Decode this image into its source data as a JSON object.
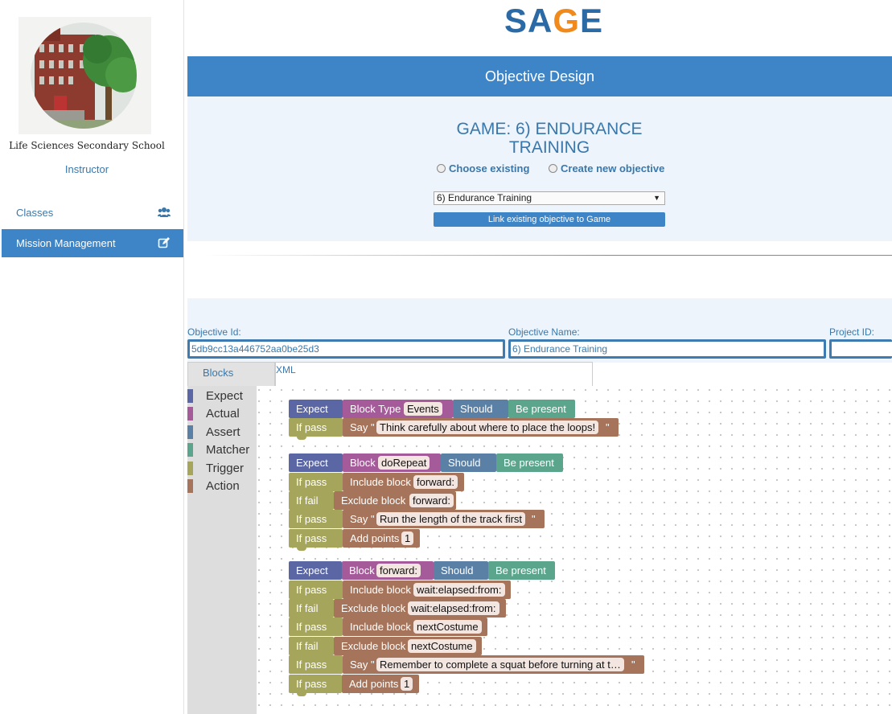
{
  "sidebar": {
    "school_name": "Life Sciences Secondary School",
    "role": "Instructor",
    "nav": [
      {
        "label": "Classes",
        "icon": "users-icon"
      },
      {
        "label": "Mission Management",
        "icon": "edit-icon"
      }
    ]
  },
  "header": {
    "logo_text": "SAGE",
    "bar_title": "Objective Design"
  },
  "objective": {
    "game_title": "GAME: 6) ENDURANCE TRAINING",
    "option_existing": "Choose existing",
    "option_new": "Create new objective",
    "selected": "6) Endurance Training",
    "link_button": "Link existing objective to Game"
  },
  "fields": {
    "id_label": "Objective Id:",
    "id_value": "5db9cc13a446752aa0be25d3",
    "name_label": "Objective Name:",
    "name_value": "6) Endurance Training",
    "project_label": "Project ID:",
    "project_value": ""
  },
  "tabs": {
    "blocks": "Blocks",
    "xml": "XML"
  },
  "toolbox": [
    {
      "label": "Expect",
      "color": "#5b67a5"
    },
    {
      "label": "Actual",
      "color": "#a55b99"
    },
    {
      "label": "Assert",
      "color": "#5b80a5"
    },
    {
      "label": "Matcher",
      "color": "#5ba58c"
    },
    {
      "label": "Trigger",
      "color": "#a5a55b"
    },
    {
      "label": "Action",
      "color": "#a5745b"
    }
  ],
  "blocks": {
    "expect": "Expect",
    "should": "Should",
    "be_present": "Be present",
    "if_pass": "If pass",
    "if_fail": "If fail",
    "say": "Say \"",
    "say_close": "\"",
    "include_block": "Include block",
    "exclude_block": "Exclude block",
    "add_points": "Add points",
    "g1": {
      "actual": "Block Type",
      "field": "Events",
      "say_text": "Think carefully about where to place the loops!"
    },
    "g2": {
      "actual": "Block",
      "field": "doRepeat",
      "include": "forward:",
      "exclude": "forward:",
      "say_text": "Run the length of the track first",
      "points": "1"
    },
    "g3": {
      "actual": "Block",
      "field": "forward:",
      "include1": "wait:elapsed:from:",
      "exclude1": "wait:elapsed:from:",
      "include2": "nextCostume",
      "exclude2": "nextCostume",
      "say_text": "Remember to complete a squat before turning at t…",
      "points": "1"
    }
  }
}
